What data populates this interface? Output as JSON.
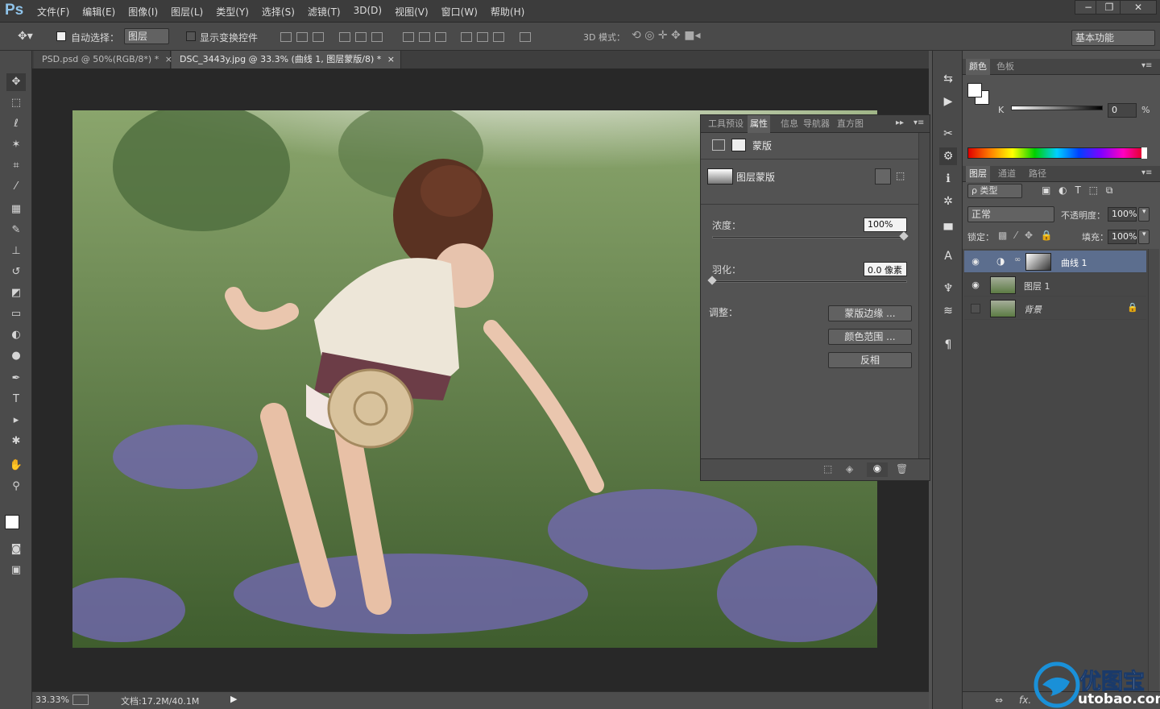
{
  "app": {
    "logo": "Ps"
  },
  "menu": [
    "文件(F)",
    "编辑(E)",
    "图像(I)",
    "图层(L)",
    "类型(Y)",
    "选择(S)",
    "滤镜(T)",
    "3D(D)",
    "视图(V)",
    "窗口(W)",
    "帮助(H)"
  ],
  "window_controls": {
    "minimize": "−",
    "restore": "❐",
    "close": "✕"
  },
  "options": {
    "auto_select_label": "自动选择：",
    "auto_select_value": "图层",
    "transform_label": "显示变换控件",
    "mode3d_label": "3D 模式：",
    "workspace": "基本功能"
  },
  "tabs": [
    {
      "label": "PSD.psd @ 50%(RGB/8*) *",
      "close": "×"
    },
    {
      "label": "DSC_3443y.jpg @ 33.3% (曲线 1, 图层蒙版/8) *",
      "close": "×"
    }
  ],
  "statusbar": {
    "zoom": "33.33%",
    "doc": "文档:17.2M/40.1M"
  },
  "props": {
    "tabs": [
      "工具预设",
      "属性",
      "信息",
      "导航器",
      "直方图"
    ],
    "header": "蒙版",
    "mask_type": "图层蒙版",
    "density_label": "浓度：",
    "density_value": "100%",
    "density_level": 1.0,
    "feather_label": "羽化：",
    "feather_value": "0.0 像素",
    "feather_level": 0.0,
    "adjust_label": "调整：",
    "buttons": [
      "蒙版边缘 ...",
      "颜色范围 ...",
      "反相"
    ]
  },
  "color_panel": {
    "tabs": [
      "颜色",
      "色板"
    ],
    "channel": "K",
    "value": "0",
    "unit": "%"
  },
  "layers_panel": {
    "tabs": [
      "图层",
      "通道",
      "路径"
    ],
    "filter": "ρ 类型",
    "blend": "正常",
    "opacity_label": "不透明度：",
    "opacity": "100%",
    "lock_label": "锁定：",
    "fill_label": "填充：",
    "fill": "100%",
    "layers": [
      {
        "name": "曲线 1",
        "visible": true,
        "selected": true
      },
      {
        "name": "图层 1",
        "visible": true,
        "selected": false
      },
      {
        "name": "背景",
        "visible": false,
        "selected": false
      }
    ],
    "footer": [
      "⇔",
      "fx."
    ]
  },
  "watermark": {
    "brand": "优图宝",
    "url": "utobao.com"
  },
  "colors": {
    "accent": "#5c6e8e",
    "panel": "#535353",
    "dark": "#3c3c3c"
  }
}
